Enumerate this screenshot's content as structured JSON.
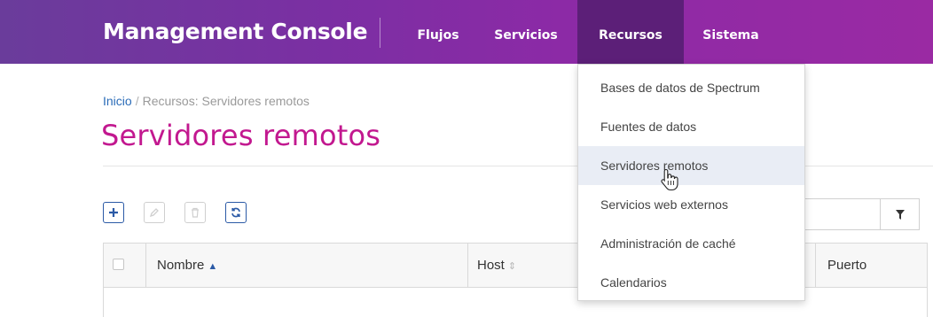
{
  "app": {
    "title": "Management Console"
  },
  "nav": {
    "items": [
      {
        "label": "Flujos"
      },
      {
        "label": "Servicios"
      },
      {
        "label": "Recursos"
      },
      {
        "label": "Sistema"
      }
    ]
  },
  "breadcrumb": {
    "home": "Inicio",
    "separator": "/",
    "current": "Recursos: Servidores remotos"
  },
  "page": {
    "title": "Servidores remotos"
  },
  "dropdown": {
    "items": [
      {
        "label": "Bases de datos de Spectrum"
      },
      {
        "label": "Fuentes de datos"
      },
      {
        "label": "Servidores remotos"
      },
      {
        "label": "Servicios web externos"
      },
      {
        "label": "Administración de caché"
      },
      {
        "label": "Calendarios"
      }
    ]
  },
  "table": {
    "columns": [
      {
        "label": "Nombre"
      },
      {
        "label": "Host"
      },
      {
        "label": "Puerto"
      }
    ]
  },
  "colors": {
    "accent": "#c2188f",
    "link": "#2b6cb8",
    "nav_active": "#5c1f78",
    "hover_row": "#e9edf5"
  }
}
